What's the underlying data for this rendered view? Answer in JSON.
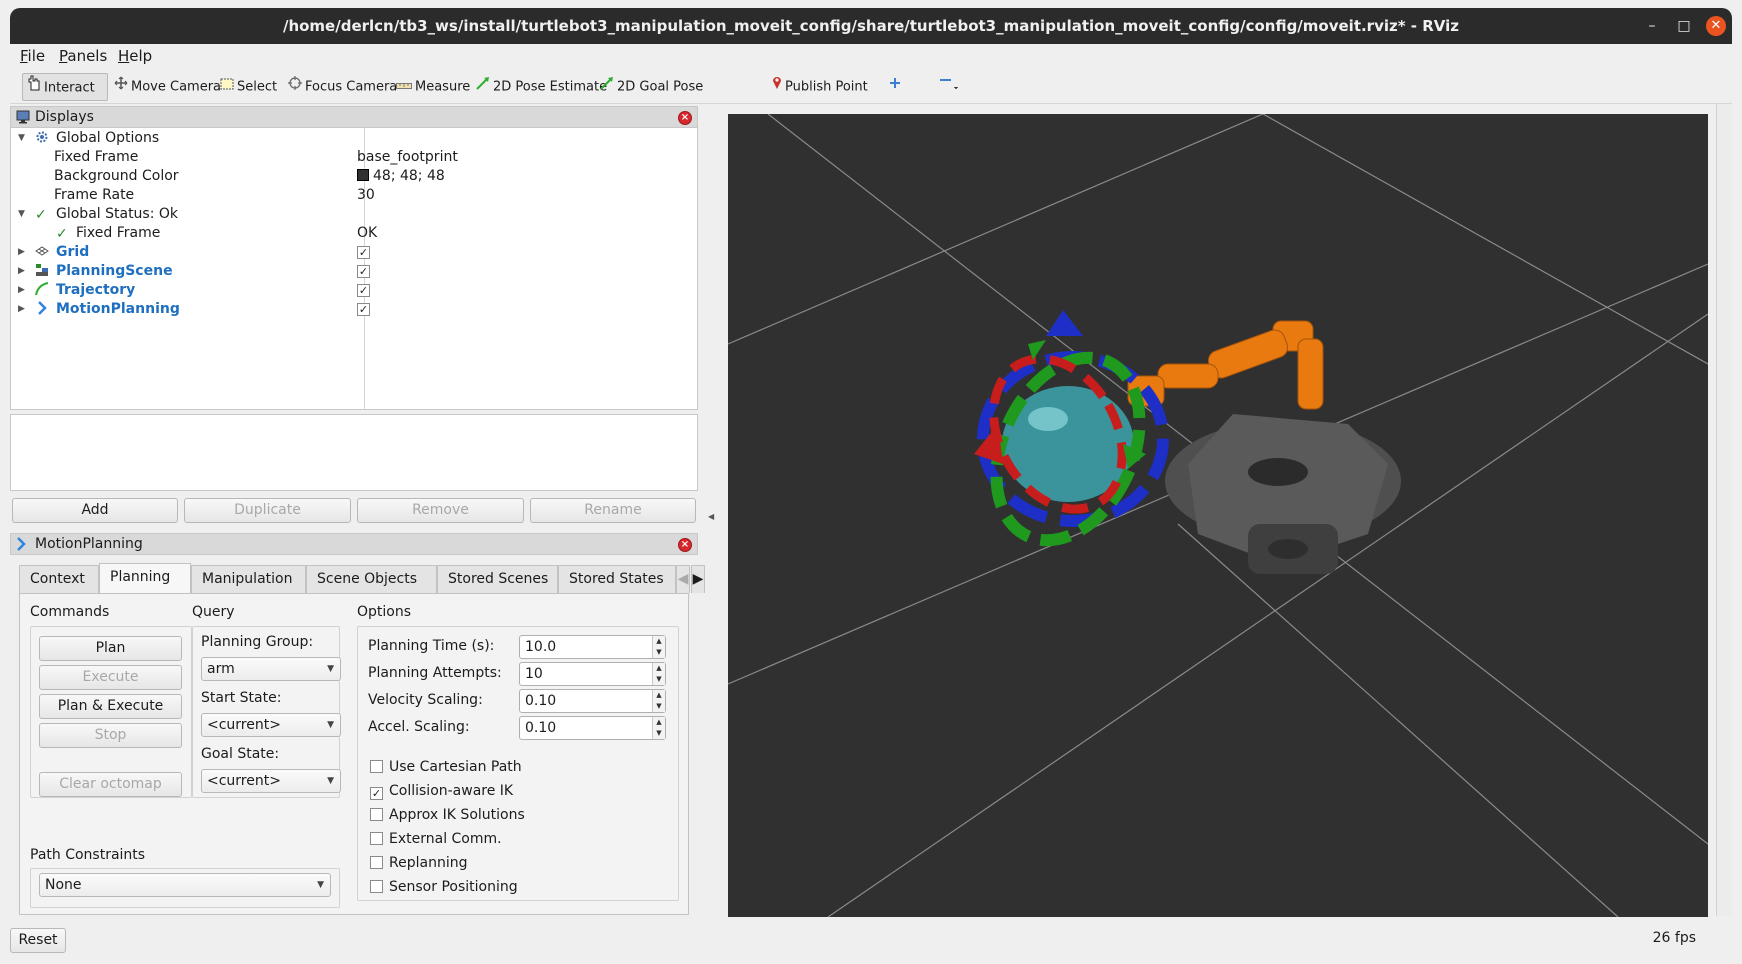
{
  "window": {
    "title": "/home/derlcn/tb3_ws/install/turtlebot3_manipulation_moveit_config/share/turtlebot3_manipulation_moveit_config/config/moveit.rviz* - RViz",
    "minimize": "–",
    "maximize": "□",
    "close": "✕"
  },
  "menu": {
    "file": "File",
    "panels": "Panels",
    "help": "Help"
  },
  "toolbar": {
    "interact": "Interact",
    "move_camera": "Move Camera",
    "select": "Select",
    "focus_camera": "Focus Camera",
    "measure": "Measure",
    "pose_estimate": "2D Pose Estimate",
    "goal_pose": "2D Goal Pose",
    "publish_point": "Publish Point"
  },
  "displays": {
    "title": "Displays",
    "rows": {
      "global_options": "Global Options",
      "fixed_frame": "Fixed Frame",
      "fixed_frame_value": "base_footprint",
      "background_color": "Background Color",
      "background_color_value": "48; 48; 48",
      "frame_rate": "Frame Rate",
      "frame_rate_value": "30",
      "global_status": "Global Status: Ok",
      "status_fixed_frame": "Fixed Frame",
      "status_fixed_frame_value": "OK",
      "grid": "Grid",
      "planning_scene": "PlanningScene",
      "trajectory": "Trajectory",
      "motion_planning": "MotionPlanning"
    },
    "buttons": {
      "add": "Add",
      "duplicate": "Duplicate",
      "remove": "Remove",
      "rename": "Rename"
    }
  },
  "motion_planning": {
    "title": "MotionPlanning",
    "tabs": [
      "Context",
      "Planning",
      "Manipulation",
      "Scene Objects",
      "Stored Scenes",
      "Stored States"
    ],
    "commands": {
      "label": "Commands",
      "plan": "Plan",
      "execute": "Execute",
      "plan_execute": "Plan & Execute",
      "stop": "Stop",
      "clear_octomap": "Clear octomap"
    },
    "query": {
      "label": "Query",
      "planning_group_label": "Planning Group:",
      "planning_group": "arm",
      "start_state_label": "Start State:",
      "start_state": "<current>",
      "goal_state_label": "Goal State:",
      "goal_state": "<current>"
    },
    "options": {
      "label": "Options",
      "planning_time_label": "Planning Time (s):",
      "planning_time": "10.0",
      "planning_attempts_label": "Planning Attempts:",
      "planning_attempts": "10",
      "velocity_scaling_label": "Velocity Scaling:",
      "velocity_scaling": "0.10",
      "accel_scaling_label": "Accel. Scaling:",
      "accel_scaling": "0.10",
      "use_cartesian_path": "Use Cartesian Path",
      "collision_aware_ik": "Collision-aware IK",
      "approx_ik": "Approx IK Solutions",
      "external_comm": "External Comm.",
      "replanning": "Replanning",
      "sensor_positioning": "Sensor Positioning"
    },
    "path_constraints": {
      "label": "Path Constraints",
      "value": "None"
    }
  },
  "status": {
    "reset": "Reset",
    "fps": "26 fps"
  },
  "colors": {
    "background": "#303030",
    "grid_line": "#8a8a8a",
    "robot_arm": "#e87a10",
    "robot_base": "#555555",
    "marker_sphere": "#3fb6bf"
  }
}
